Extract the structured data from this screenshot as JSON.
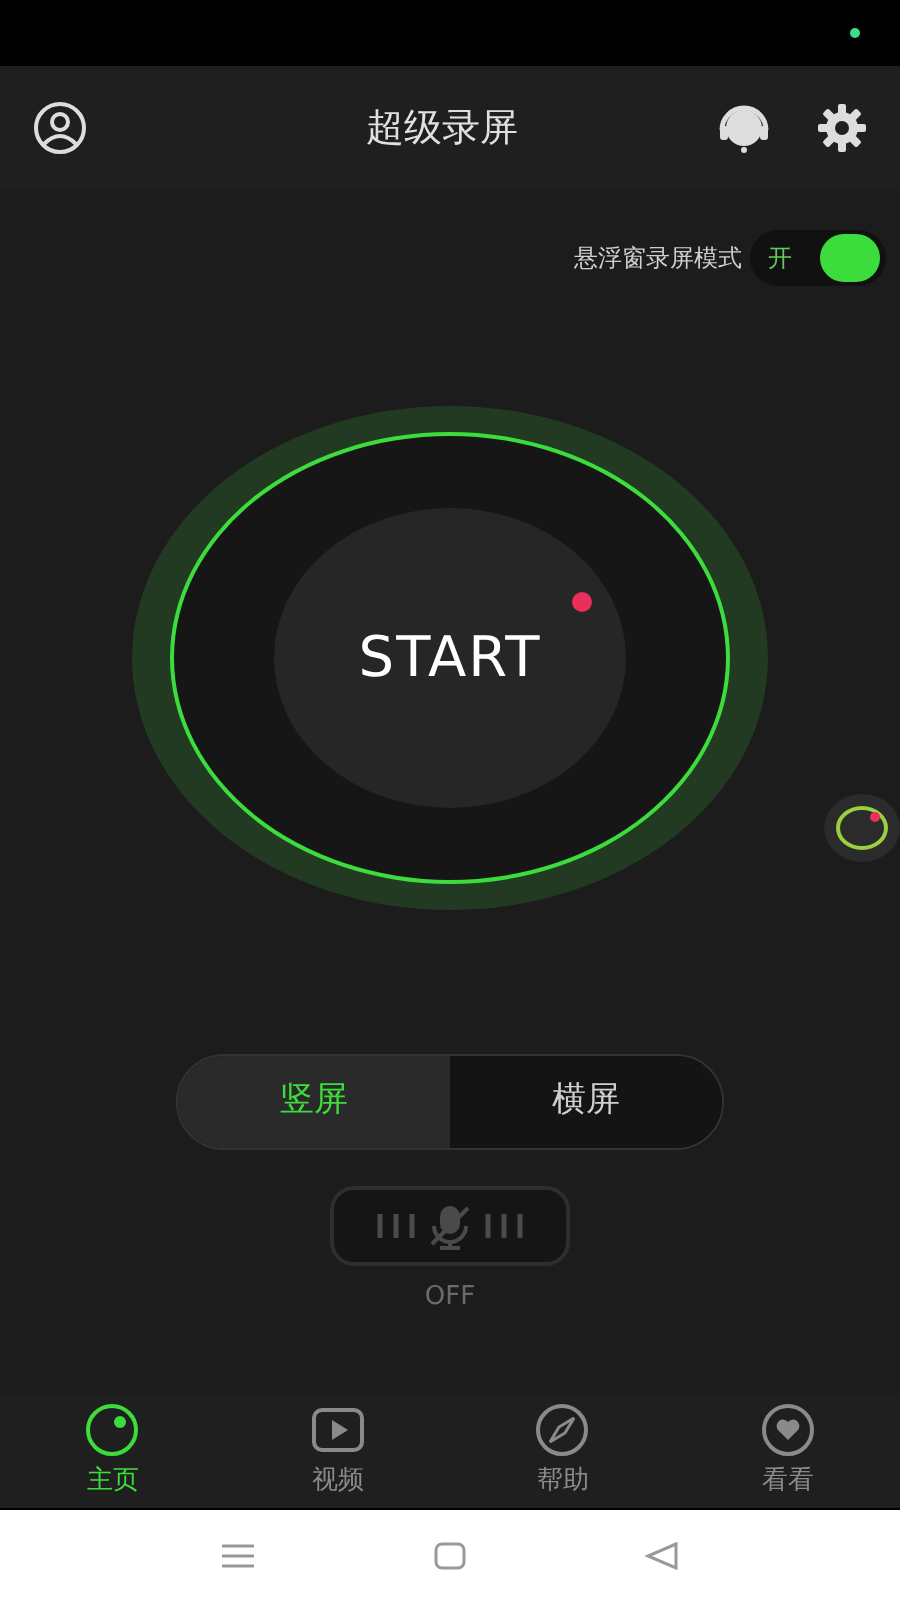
{
  "header": {
    "title": "超级录屏"
  },
  "float_mode": {
    "label": "悬浮窗录屏模式",
    "toggle_text": "开",
    "on": true
  },
  "start_button": {
    "label": "START"
  },
  "orientation_tabs": [
    {
      "label": "竖屏",
      "selected": true
    },
    {
      "label": "横屏",
      "selected": false
    }
  ],
  "microphone": {
    "on": false,
    "status": "OFF"
  },
  "bottom_nav": [
    {
      "label": "主页",
      "kind": "home",
      "selected": true
    },
    {
      "label": "视频",
      "kind": "video",
      "selected": false
    },
    {
      "label": "帮助",
      "kind": "help",
      "selected": false
    },
    {
      "label": "看看",
      "kind": "like",
      "selected": false
    }
  ]
}
